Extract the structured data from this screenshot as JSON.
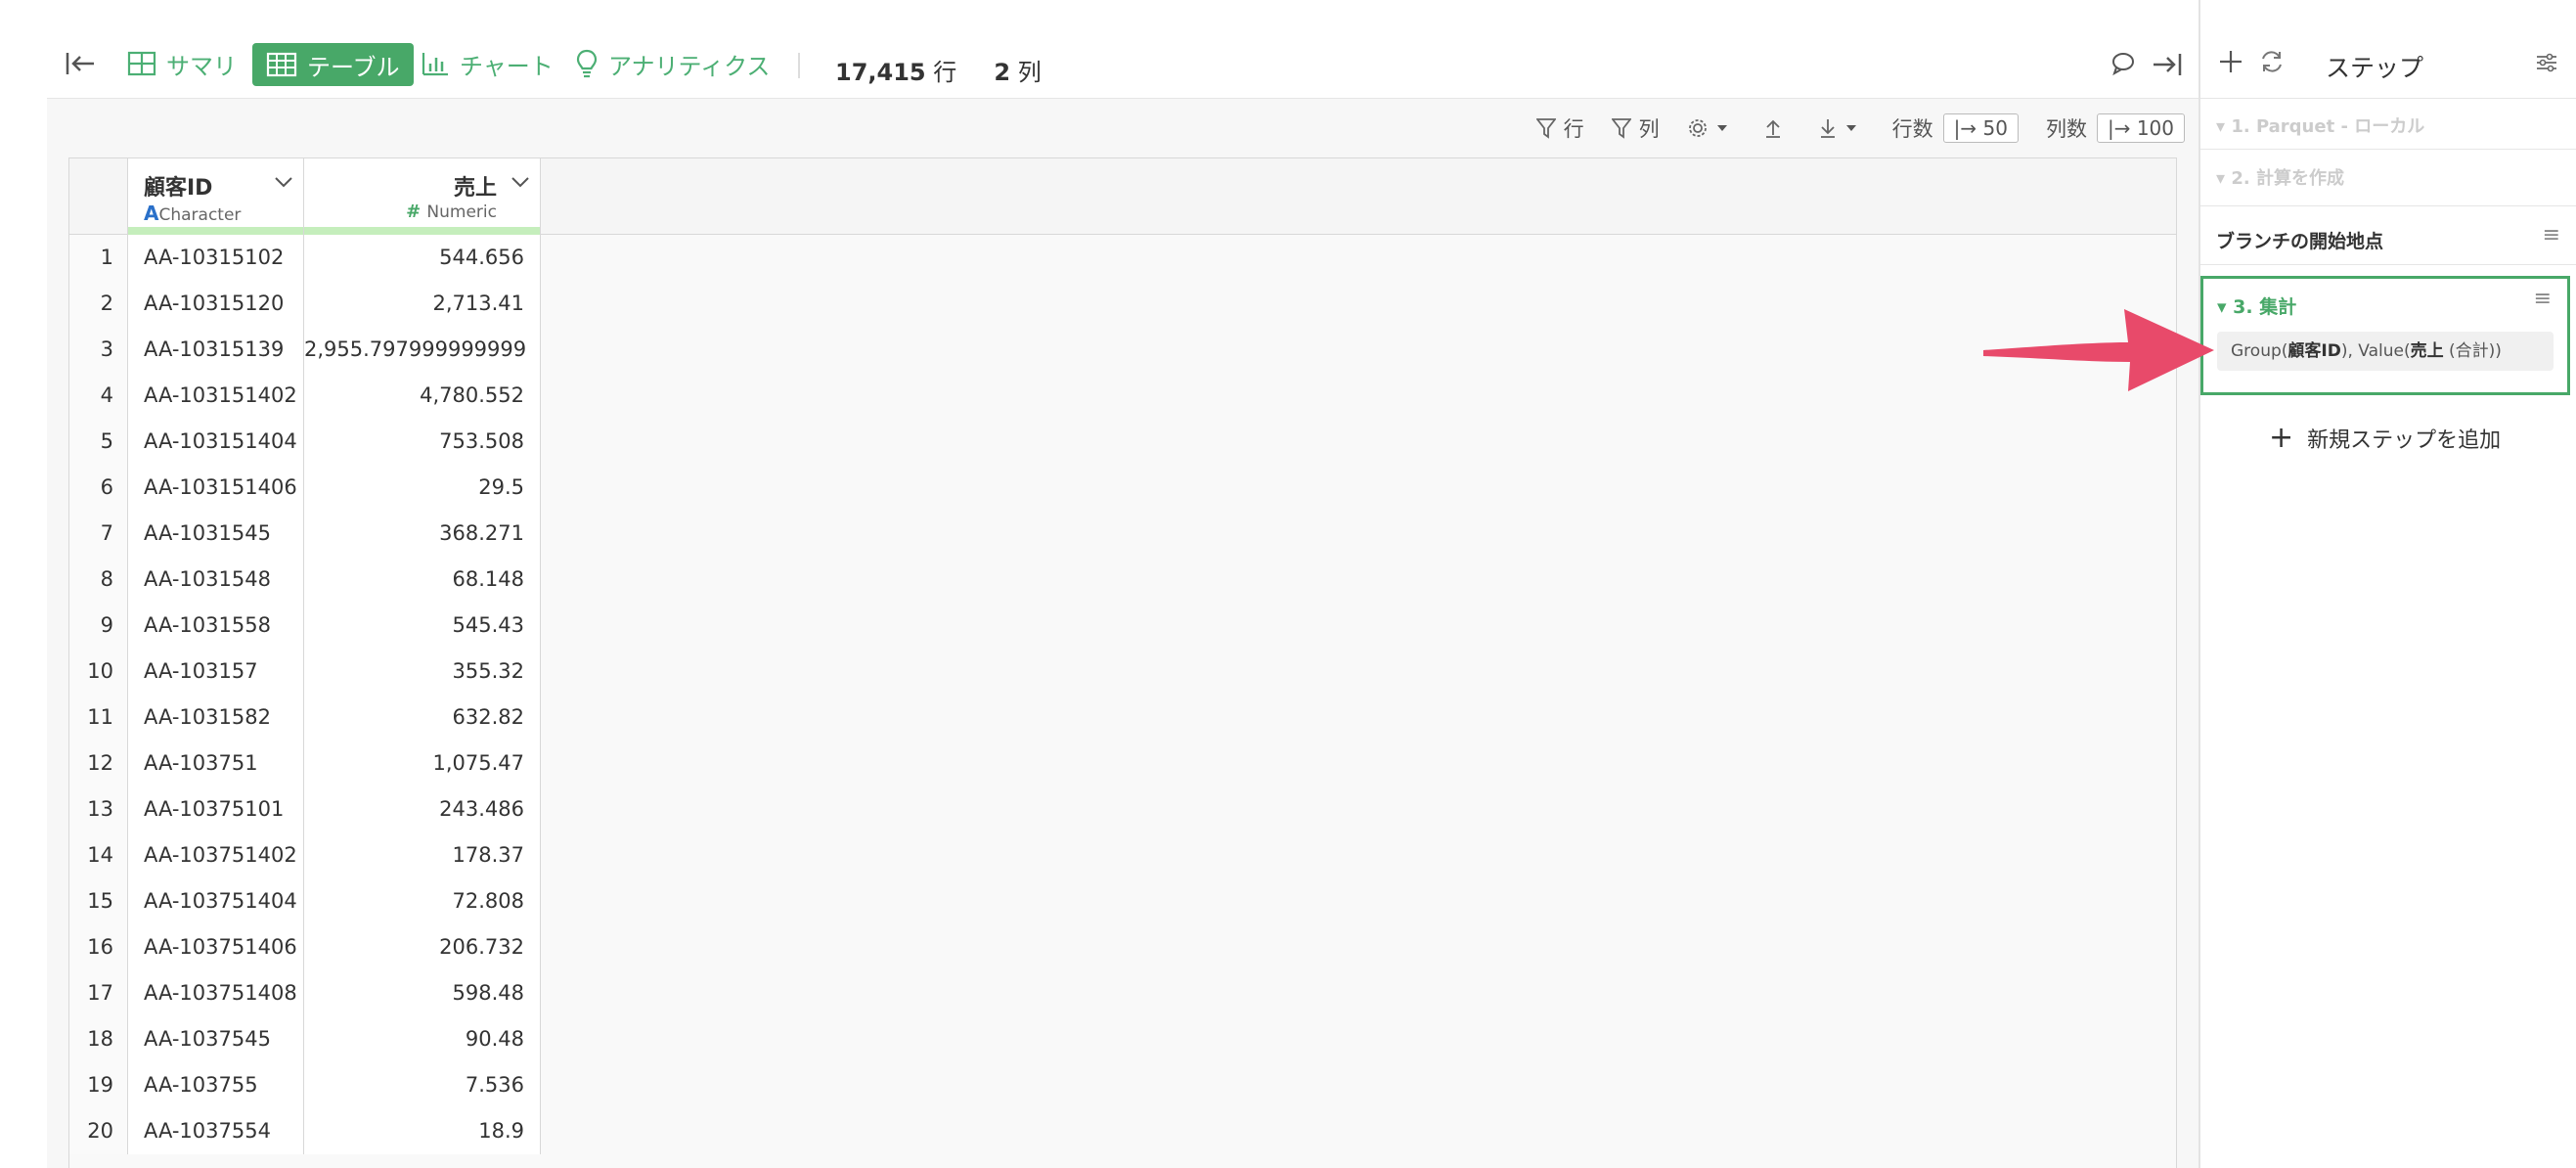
{
  "toolbar": {
    "tabs": [
      {
        "label": "サマリ"
      },
      {
        "label": "テーブル"
      },
      {
        "label": "チャート"
      },
      {
        "label": "アナリティクス"
      }
    ],
    "rows_value": "17,415",
    "rows_unit": "行",
    "cols_value": "2",
    "cols_unit": "列"
  },
  "subbar": {
    "filter_rows": "行",
    "filter_cols": "列",
    "row_count_label": "行数",
    "row_count_value": "|→ 50",
    "col_count_label": "列数",
    "col_count_value": "|→ 100"
  },
  "table": {
    "columns": [
      {
        "name": "顧客ID",
        "type": "Character"
      },
      {
        "name": "売上",
        "type": "Numeric"
      }
    ],
    "rows": [
      {
        "n": "1",
        "id": "AA-10315102",
        "sales": "544.656"
      },
      {
        "n": "2",
        "id": "AA-10315120",
        "sales": "2,713.41"
      },
      {
        "n": "3",
        "id": "AA-10315139",
        "sales": "2,955.797999999999"
      },
      {
        "n": "4",
        "id": "AA-103151402",
        "sales": "4,780.552"
      },
      {
        "n": "5",
        "id": "AA-103151404",
        "sales": "753.508"
      },
      {
        "n": "6",
        "id": "AA-103151406",
        "sales": "29.5"
      },
      {
        "n": "7",
        "id": "AA-1031545",
        "sales": "368.271"
      },
      {
        "n": "8",
        "id": "AA-1031548",
        "sales": "68.148"
      },
      {
        "n": "9",
        "id": "AA-1031558",
        "sales": "545.43"
      },
      {
        "n": "10",
        "id": "AA-103157",
        "sales": "355.32"
      },
      {
        "n": "11",
        "id": "AA-1031582",
        "sales": "632.82"
      },
      {
        "n": "12",
        "id": "AA-103751",
        "sales": "1,075.47"
      },
      {
        "n": "13",
        "id": "AA-10375101",
        "sales": "243.486"
      },
      {
        "n": "14",
        "id": "AA-103751402",
        "sales": "178.37"
      },
      {
        "n": "15",
        "id": "AA-103751404",
        "sales": "72.808"
      },
      {
        "n": "16",
        "id": "AA-103751406",
        "sales": "206.732"
      },
      {
        "n": "17",
        "id": "AA-103751408",
        "sales": "598.48"
      },
      {
        "n": "18",
        "id": "AA-1037545",
        "sales": "90.48"
      },
      {
        "n": "19",
        "id": "AA-103755",
        "sales": "7.536"
      },
      {
        "n": "20",
        "id": "AA-1037554",
        "sales": "18.9"
      }
    ]
  },
  "panel": {
    "title": "ステップ",
    "step1": "1. Parquet - ローカル",
    "step2": "2. 計算を作成",
    "branch": "ブランチの開始地点",
    "step3": "3. 集計",
    "cmd_pre": "Group(",
    "cmd_b1": "顧客ID",
    "cmd_mid": "), Value(",
    "cmd_b2": "売上",
    "cmd_post": " (合計))",
    "add_step": "新規ステップを追加"
  },
  "colors": {
    "accent": "#48a868",
    "arrow": "#e84a6a",
    "character_type": "#2a70c9"
  }
}
